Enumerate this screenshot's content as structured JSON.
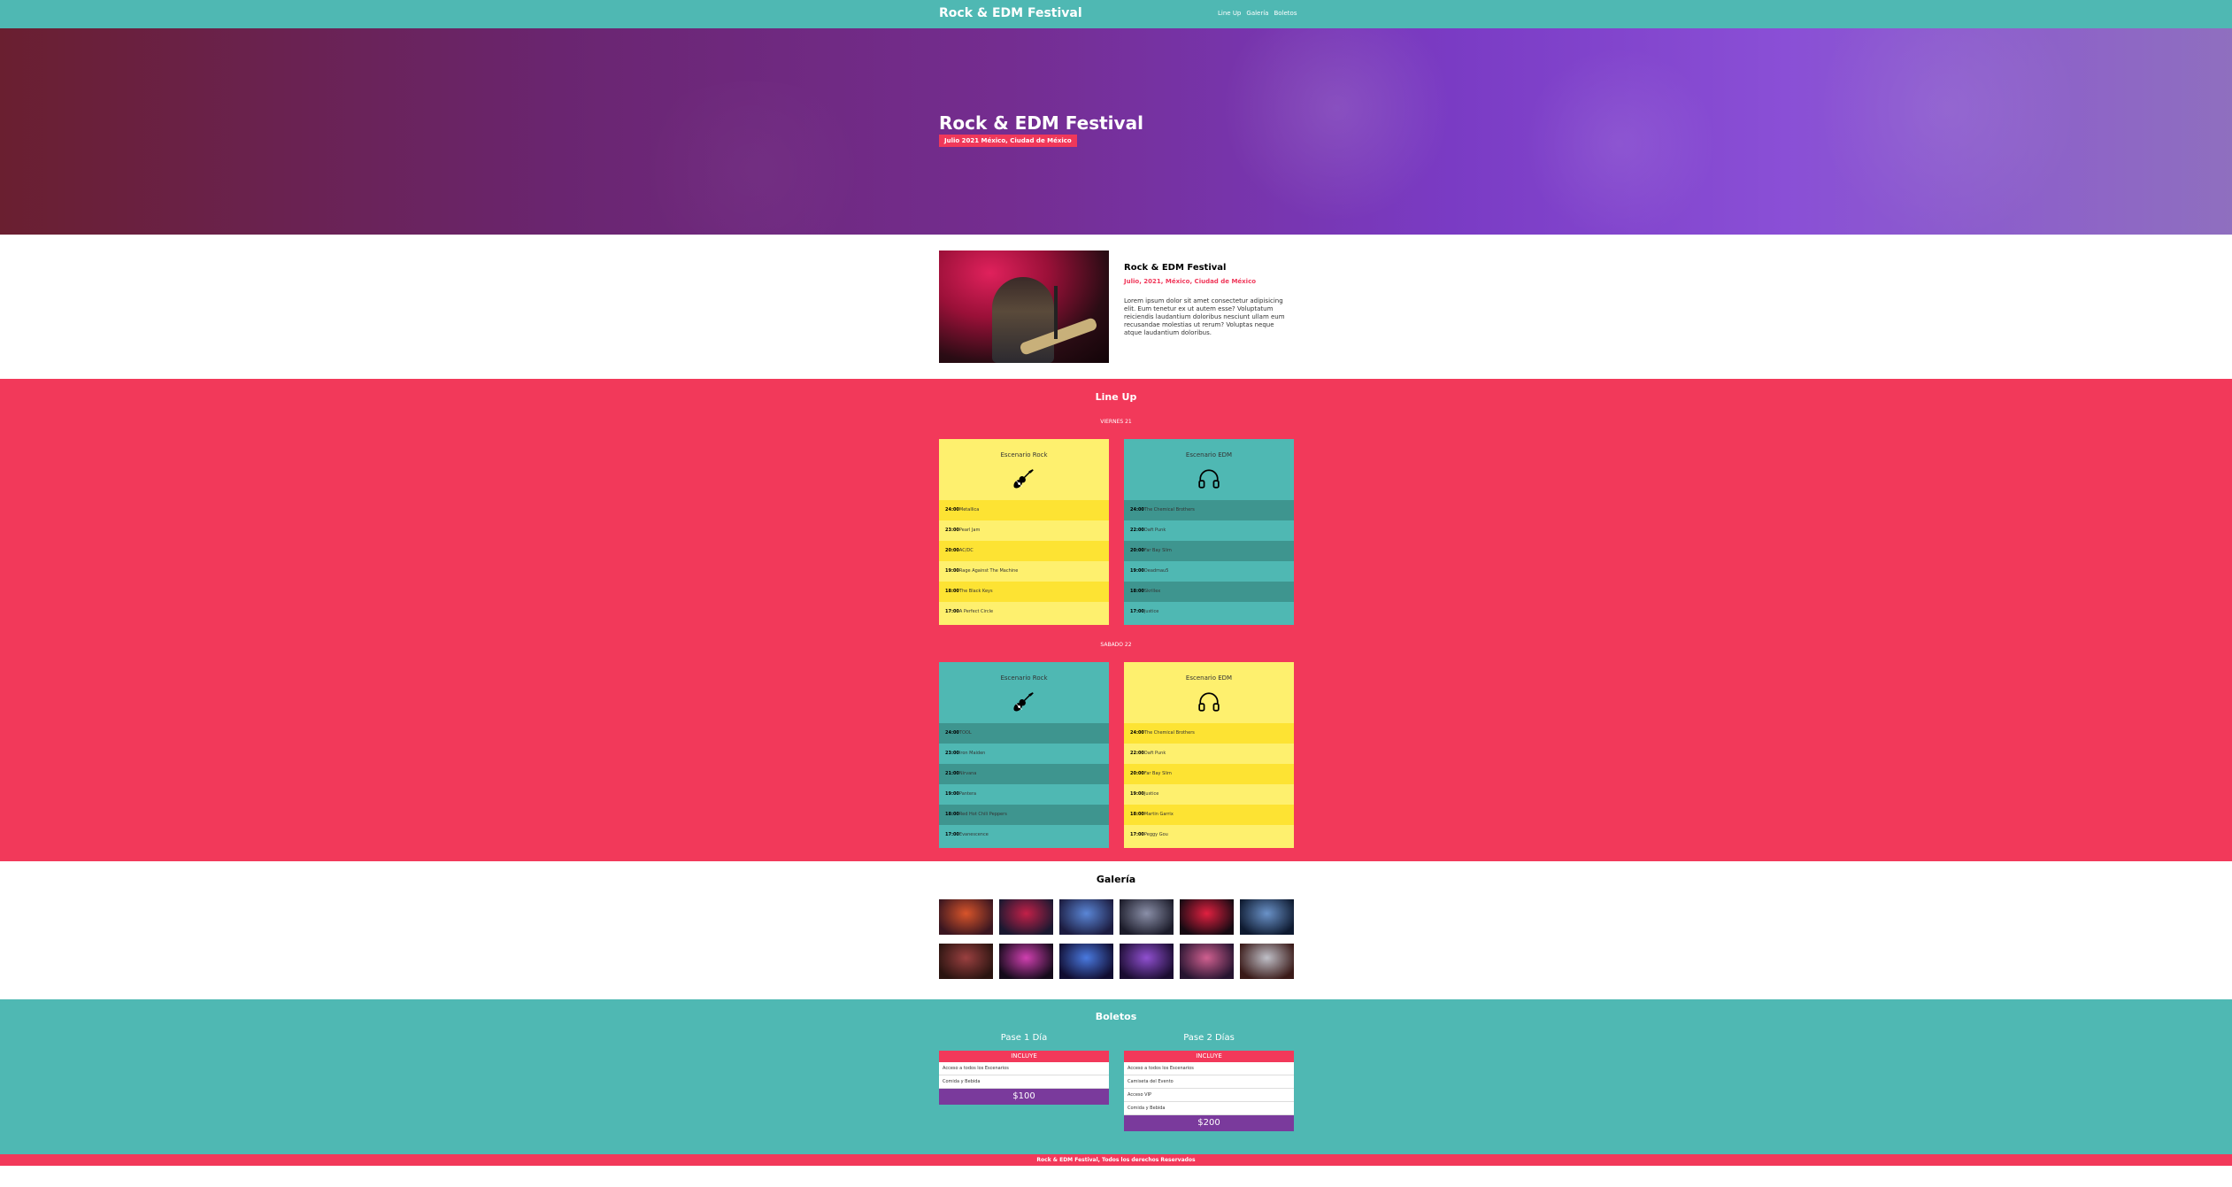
{
  "header": {
    "logo": "Rock & EDM Festival",
    "nav": [
      "Line Up",
      "Galería",
      "Boletos"
    ]
  },
  "hero": {
    "title": "Rock & EDM Festival",
    "badge": "Julio 2021 México, Ciudad de México"
  },
  "about": {
    "title": "Rock & EDM Festival",
    "subtitle": "Julio, 2021, México, Ciudad de México",
    "text": "Lorem ipsum dolor sit amet consectetur adipisicing elit. Eum tenetur ex ut autem esse? Voluptatum reiciendis laudantium doloribus nesciunt ullam eum recusandae molestias ut rerum? Voluptas neque atque laudantium doloribus."
  },
  "lineup": {
    "title": "Line Up",
    "days": [
      {
        "label": "VIERNES 21",
        "stages": [
          {
            "name": "Escenario Rock",
            "icon": "guitar-icon",
            "theme": "yellow",
            "rows": [
              {
                "time": "24:00",
                "artist": "Metallica"
              },
              {
                "time": "23:00",
                "artist": "Pearl Jam"
              },
              {
                "time": "20:00",
                "artist": "AC/DC"
              },
              {
                "time": "19:00",
                "artist": "Rage Against The Machine"
              },
              {
                "time": "18:00",
                "artist": "The Black Keys"
              },
              {
                "time": "17:00",
                "artist": "A Perfect Circle"
              }
            ]
          },
          {
            "name": "Escenario EDM",
            "icon": "headphones-icon",
            "theme": "teal",
            "rows": [
              {
                "time": "24:00",
                "artist": "The Chemical Brothers"
              },
              {
                "time": "22:00",
                "artist": "Daft Punk"
              },
              {
                "time": "20:00",
                "artist": "Far Bay Slim"
              },
              {
                "time": "19:00",
                "artist": "Deadmau5"
              },
              {
                "time": "18:00",
                "artist": "Skrillex"
              },
              {
                "time": "17:00",
                "artist": "Justice"
              }
            ]
          }
        ]
      },
      {
        "label": "SABADO 22",
        "stages": [
          {
            "name": "Escenario Rock",
            "icon": "guitar-icon",
            "theme": "teal",
            "rows": [
              {
                "time": "24:00",
                "artist": "TOOL"
              },
              {
                "time": "23:00",
                "artist": "Iron Maiden"
              },
              {
                "time": "21:00",
                "artist": "Nirvana"
              },
              {
                "time": "19:00",
                "artist": "Pantera"
              },
              {
                "time": "18:00",
                "artist": "Red Hot Chili Peppers"
              },
              {
                "time": "17:00",
                "artist": "Evanescence"
              }
            ]
          },
          {
            "name": "Escenario EDM",
            "icon": "headphones-icon",
            "theme": "yellow",
            "rows": [
              {
                "time": "24:00",
                "artist": "The Chemical Brothers"
              },
              {
                "time": "22:00",
                "artist": "Daft Punk"
              },
              {
                "time": "20:00",
                "artist": "Far Bay Slim"
              },
              {
                "time": "19:00",
                "artist": "Justice"
              },
              {
                "time": "18:00",
                "artist": "Martin Garrix"
              },
              {
                "time": "17:00",
                "artist": "Peggy Gou"
              }
            ]
          }
        ]
      }
    ]
  },
  "gallery": {
    "title": "Galería",
    "thumbs": [
      {
        "colors": [
          "#d8542a",
          "#3a1620"
        ]
      },
      {
        "colors": [
          "#c22048",
          "#1a1830"
        ]
      },
      {
        "colors": [
          "#5a86d6",
          "#1c1c40"
        ]
      },
      {
        "colors": [
          "#8a8fa8",
          "#1c1c2a"
        ]
      },
      {
        "colors": [
          "#e02040",
          "#160a12"
        ]
      },
      {
        "colors": [
          "#6a92c8",
          "#0e1a30"
        ]
      },
      {
        "colors": [
          "#9a4040",
          "#2a1410"
        ]
      },
      {
        "colors": [
          "#d040b0",
          "#140a1a"
        ]
      },
      {
        "colors": [
          "#4a7ae0",
          "#100c30"
        ]
      },
      {
        "colors": [
          "#9050d0",
          "#1a0c30"
        ]
      },
      {
        "colors": [
          "#d06090",
          "#261430"
        ]
      },
      {
        "colors": [
          "#c0c0c8",
          "#3a1a18"
        ]
      }
    ]
  },
  "tickets": {
    "title": "Boletos",
    "passes": [
      {
        "name": "Pase 1 Día",
        "includes_label": "INCLUYE",
        "items": [
          "Acceso a todos los Escenarios",
          "Comida y Bebida"
        ],
        "price": "$100"
      },
      {
        "name": "Pase 2 Días",
        "includes_label": "INCLUYE",
        "items": [
          "Acceso a todos los Escenarios",
          "Camiseta del Evento",
          "Acceso VIP",
          "Comida y Bebida"
        ],
        "price": "$200"
      }
    ]
  },
  "footer": {
    "text": "Rock & EDM Festival, Todos los derechos Reservados"
  },
  "colors": {
    "teal": "#4fb8b3",
    "pink": "#f2395a",
    "yellow": "#fef06e",
    "purple": "#7a3a9c"
  }
}
